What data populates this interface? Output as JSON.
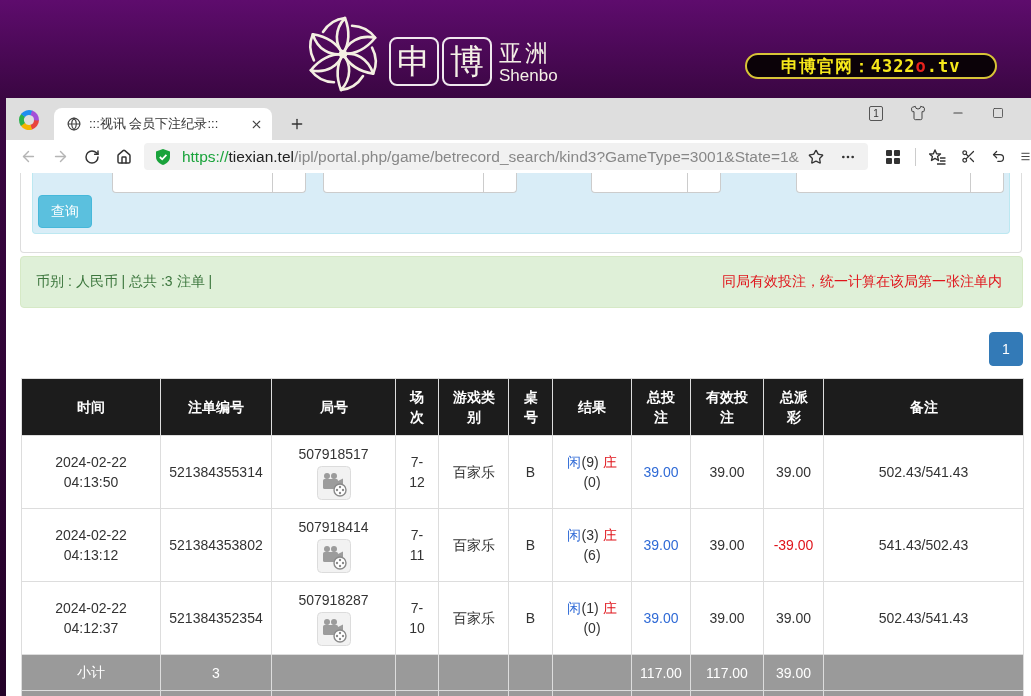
{
  "banner": {
    "logo_characters": [
      "申",
      "博"
    ],
    "brand_cn": "亚洲",
    "brand_en": "Shenbo",
    "site_address": {
      "before": "申博官网：4322",
      "accent": "o",
      "after": ".tv"
    }
  },
  "browser": {
    "tabs": [
      {
        "title": ":::视讯 会员下注纪录:::",
        "selected": true
      }
    ],
    "tab_count": "1",
    "back_disabled": true,
    "forward_disabled": true,
    "url": {
      "scheme": "https://",
      "host": "tiexian.tel",
      "path": "/ipl/portal.php/game/betrecord_search/kind3?GameType=3001&State=1&"
    }
  },
  "search_form": {
    "submit": "查询"
  },
  "summary": {
    "text": "币别 : 人民币 | 总共 :3 注单 |",
    "notice": "同局有效投注，统一计算在该局第一张注单内"
  },
  "pagination": [
    {
      "label": "1",
      "selected": true
    }
  ],
  "table": {
    "columns": [
      "时间",
      "注单编号",
      "局号",
      "场次",
      "游戏类别",
      "桌号",
      "结果",
      "总投注",
      "有效投注",
      "总派彩",
      "备注"
    ],
    "rows": [
      {
        "time": "2024-02-22 04:13:50",
        "bet_id": "521384355314",
        "round_no": "507918517",
        "shoe": "7-12",
        "game": "百家乐",
        "table_no": "B",
        "result": {
          "player": "闲",
          "player_points": "(9)",
          "banker": "庄",
          "banker_points": "(0)"
        },
        "total_bet": "39.00",
        "valid_bet": "39.00",
        "payout": "39.00",
        "payout_negative": false,
        "note": "502.43/541.43"
      },
      {
        "time": "2024-02-22 04:13:12",
        "bet_id": "521384353802",
        "round_no": "507918414",
        "shoe": "7-11",
        "game": "百家乐",
        "table_no": "B",
        "result": {
          "player": "闲",
          "player_points": "(3)",
          "banker": "庄",
          "banker_points": "(6)"
        },
        "total_bet": "39.00",
        "valid_bet": "39.00",
        "payout": "-39.00",
        "payout_negative": true,
        "note": "541.43/502.43"
      },
      {
        "time": "2024-02-22 04:12:37",
        "bet_id": "521384352354",
        "round_no": "507918287",
        "shoe": "7-10",
        "game": "百家乐",
        "table_no": "B",
        "result": {
          "player": "闲",
          "player_points": "(1)",
          "banker": "庄",
          "banker_points": "(0)"
        },
        "total_bet": "39.00",
        "valid_bet": "39.00",
        "payout": "39.00",
        "payout_negative": false,
        "note": "502.43/541.43"
      }
    ],
    "subtotal": {
      "label": "小计",
      "count": "3",
      "total_bet": "117.00",
      "valid_bet": "117.00",
      "payout": "39.00"
    }
  }
}
